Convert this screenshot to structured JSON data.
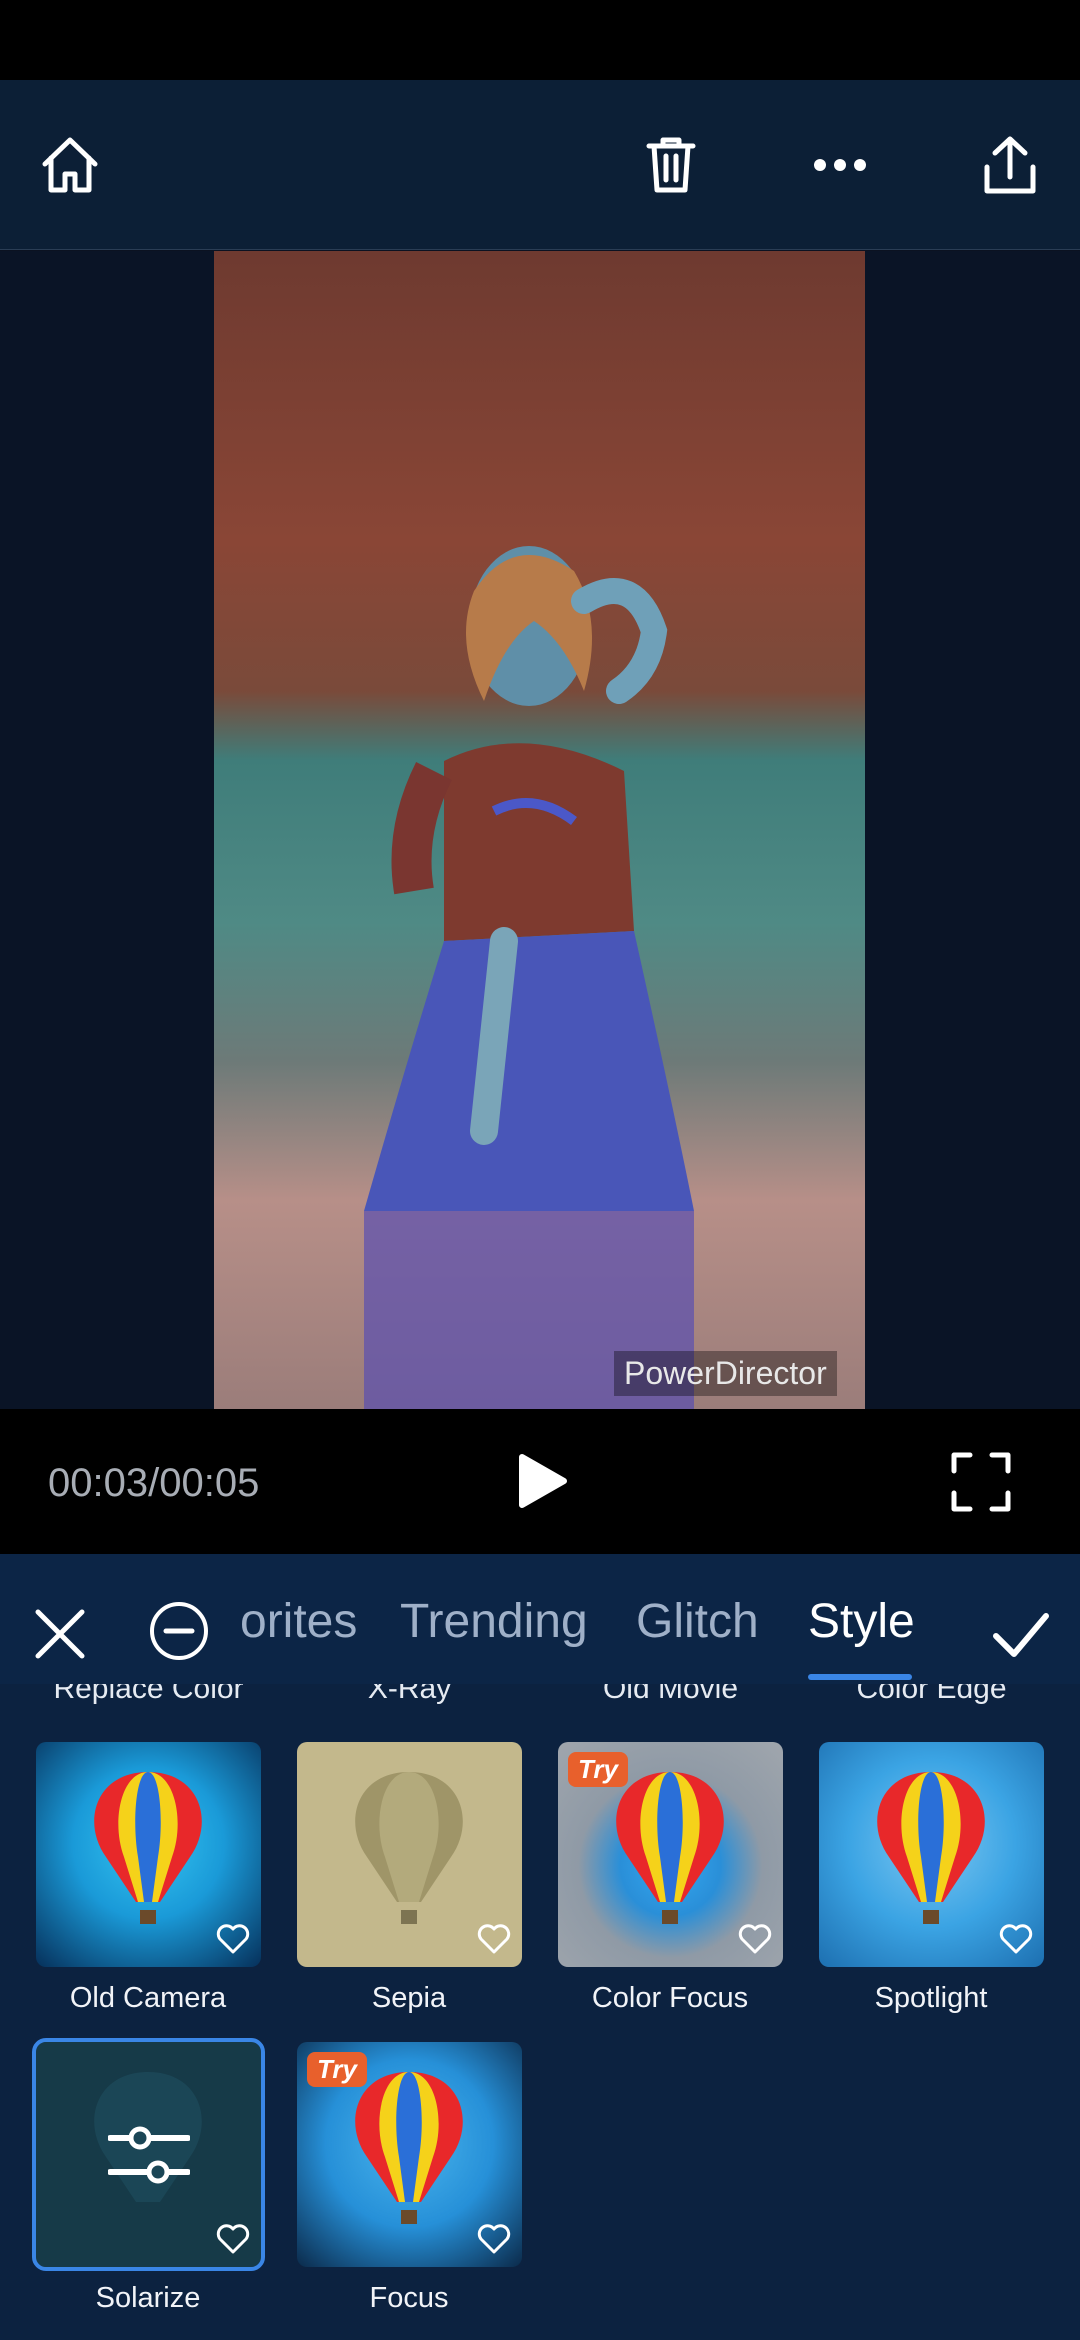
{
  "toolbar": {
    "home": "home-icon",
    "delete": "trash-icon",
    "more": "more-icon",
    "share": "share-icon"
  },
  "preview": {
    "watermark": "PowerDirector"
  },
  "playback": {
    "time": "00:03/00:05"
  },
  "effects_panel": {
    "tabs": [
      "orites",
      "Trending",
      "Glitch",
      "Style"
    ],
    "active_tab": "Style",
    "cut_labels": [
      "Replace Color",
      "X-Ray",
      "Old Movie",
      "Color Edge"
    ],
    "tiles": [
      {
        "label": "Old Camera",
        "try": "",
        "style": "old-camera"
      },
      {
        "label": "Sepia",
        "try": "",
        "style": "sepia"
      },
      {
        "label": "Color Focus",
        "try": "Try",
        "style": "color-focus"
      },
      {
        "label": "Spotlight",
        "try": "",
        "style": "spotlight"
      },
      {
        "label": "Solarize",
        "try": "",
        "style": "solarize"
      },
      {
        "label": "Focus",
        "try": "Try",
        "style": "focus"
      }
    ],
    "selected": "Solarize"
  },
  "colors": {
    "accent": "#3a86e6",
    "try_badge": "#e8602c",
    "panel_bg": "#0c2240"
  }
}
